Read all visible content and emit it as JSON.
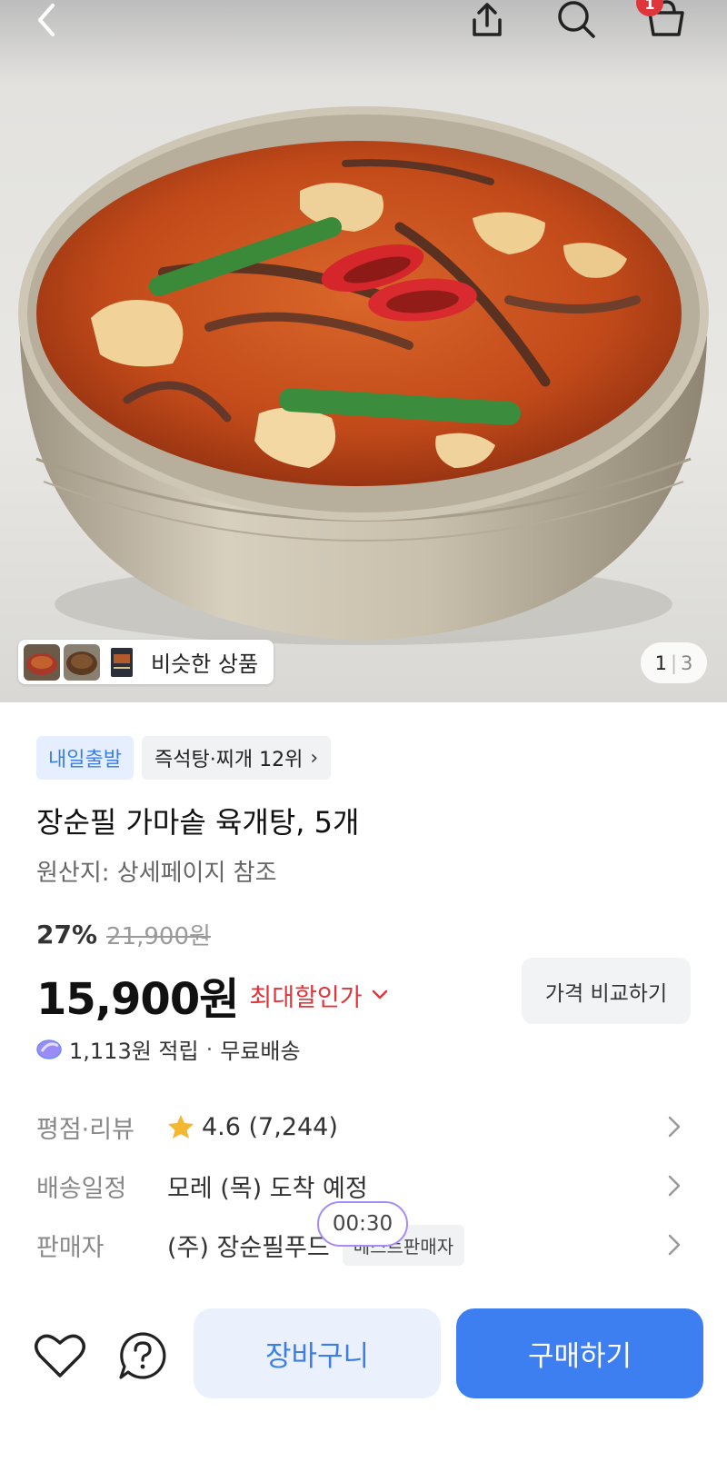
{
  "header": {
    "back_icon": "chevron-left-icon",
    "share_icon": "share-icon",
    "search_icon": "search-icon",
    "cart_icon": "cart-icon",
    "cart_badge": "1"
  },
  "gallery": {
    "similar_label": "비슷한 상품",
    "page_current": "1",
    "page_total": "3"
  },
  "product": {
    "tag_delivery": "내일출발",
    "tag_rank": "즉석탕·찌개 12위",
    "title": "장순필 가마솥 육개탕, 5개",
    "origin": "원산지: 상세페이지 참조",
    "discount_percent": "27%",
    "original_price": "21,900원",
    "price": "15,900원",
    "max_discount_label": "최대할인가",
    "compare_button": "가격 비교하기",
    "points": "1,113원 적립",
    "shipping": "무료배송"
  },
  "info_rows": {
    "rating_label": "평점·리뷰",
    "rating_value": "4.6 (7,244)",
    "delivery_label": "배송일정",
    "delivery_value": "모레 (목) 도착 예정",
    "seller_label": "판매자",
    "seller_value": "(주) 장순필푸드",
    "seller_badge": "베스트판매자"
  },
  "overlay": {
    "timer": "00:30"
  },
  "bottom_bar": {
    "wishlist_icon": "heart-icon",
    "inquiry_icon": "question-icon",
    "cart_button": "장바구니",
    "buy_button": "구매하기"
  },
  "colors": {
    "accent_blue": "#3d7ff0",
    "discount_red": "#e0353b",
    "tag_blue_bg": "#e6efff"
  }
}
